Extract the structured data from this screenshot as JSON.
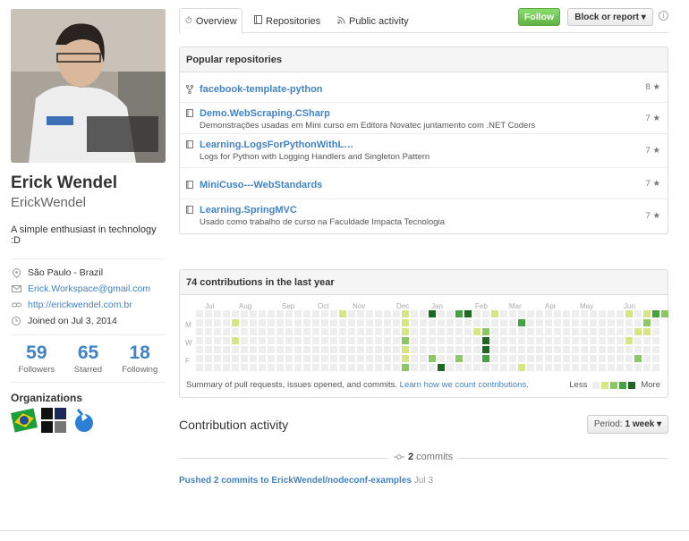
{
  "profile": {
    "fullname": "Erick Wendel",
    "username": "ErickWendel",
    "bio": "A simple enthusiast in technology :D",
    "location": "São Paulo - Brazil",
    "email": "Erick.Workspace@gmail.com",
    "website": "http://erickwendel.com.br",
    "joined": "Joined on Jul 3, 2014",
    "stats": [
      {
        "num": "59",
        "label": "Followers"
      },
      {
        "num": "65",
        "label": "Starred"
      },
      {
        "num": "18",
        "label": "Following"
      }
    ],
    "organizations_label": "Organizations"
  },
  "tabs": [
    {
      "label": "Overview",
      "icon": "clock-icon"
    },
    {
      "label": "Repositories",
      "icon": "book-icon"
    },
    {
      "label": "Public activity",
      "icon": "rss-icon"
    }
  ],
  "actions": {
    "follow": "Follow",
    "block": "Block or report ▾"
  },
  "popular": {
    "title": "Popular repositories",
    "repos": [
      {
        "name": "facebook-template-python",
        "desc": "",
        "stars": "8",
        "icon": "fork-icon"
      },
      {
        "name": "Demo.WebScraping.CSharp",
        "desc": "Demonstrações usadas em Mini curso em Editora Novatec juntamento com .NET Coders",
        "stars": "7",
        "icon": "repo-icon"
      },
      {
        "name": "Learning.LogsForPythonWithL…",
        "desc": "Logs for Python with Logging Handlers and Singleton Pattern",
        "stars": "7",
        "icon": "repo-icon"
      },
      {
        "name": "MiniCuso---WebStandards",
        "desc": "",
        "stars": "7",
        "icon": "repo-icon"
      },
      {
        "name": "Learning.SpringMVC",
        "desc": "Usado como trabalho de curso na Faculdade Impacta Tecnologia",
        "stars": "7",
        "icon": "repo-icon"
      }
    ]
  },
  "contributions": {
    "title": "74 contributions in the last year",
    "months": [
      "Jul",
      "Aug",
      "Sep",
      "Oct",
      "Nov",
      "Dec",
      "Jan",
      "Feb",
      "Mar",
      "Apr",
      "May",
      "Jun"
    ],
    "days": [
      "M",
      "W",
      "F"
    ],
    "summary": "Summary of pull requests, issues opened, and commits.",
    "learn_link": "Learn how we count contributions.",
    "less": "Less",
    "more": "More",
    "colors": [
      "#eeeeee",
      "#d6e685",
      "#8cc665",
      "#44a340",
      "#1e6823"
    ]
  },
  "activity": {
    "title": "Contribution activity",
    "period_label": "Period:",
    "period_value": "1 week ▾",
    "commits_count": "2",
    "commits_word": "commits",
    "pushed_text": "Pushed 2 commits to ErickWendel/nodeconf-examples",
    "pushed_date": "Jul 3"
  }
}
